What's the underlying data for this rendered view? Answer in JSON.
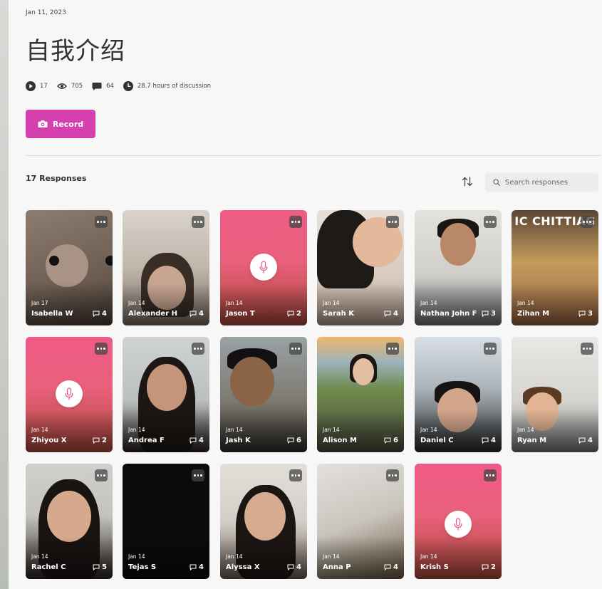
{
  "header": {
    "date": "Jan 11, 2023",
    "title": "自我介绍",
    "stats": {
      "videos": "17",
      "views": "705",
      "comments": "64",
      "hours": "28.7 hours of discussion"
    },
    "record_label": "Record"
  },
  "responses": {
    "count_label": "17 Responses",
    "search_placeholder": "Search responses",
    "items": [
      {
        "date": "Jan 17",
        "name": "Isabella W",
        "comments": "4",
        "type": "video"
      },
      {
        "date": "Jan 14",
        "name": "Alexander H",
        "comments": "4",
        "type": "video"
      },
      {
        "date": "Jan 14",
        "name": "Jason T",
        "comments": "2",
        "type": "audio"
      },
      {
        "date": "Jan 14",
        "name": "Sarah K",
        "comments": "4",
        "type": "video"
      },
      {
        "date": "Jan 14",
        "name": "Nathan John F",
        "comments": "3",
        "type": "video"
      },
      {
        "date": "Jan 14",
        "name": "Zihan M",
        "comments": "3",
        "type": "video"
      },
      {
        "date": "Jan 14",
        "name": "Zhiyou X",
        "comments": "2",
        "type": "audio"
      },
      {
        "date": "Jan 14",
        "name": "Andrea F",
        "comments": "4",
        "type": "video"
      },
      {
        "date": "Jan 14",
        "name": "Jash K",
        "comments": "6",
        "type": "video"
      },
      {
        "date": "Jan 14",
        "name": "Alison M",
        "comments": "6",
        "type": "video"
      },
      {
        "date": "Jan 14",
        "name": "Daniel C",
        "comments": "4",
        "type": "video"
      },
      {
        "date": "Jan 14",
        "name": "Ryan M",
        "comments": "4",
        "type": "video"
      },
      {
        "date": "Jan 14",
        "name": "Rachel C",
        "comments": "5",
        "type": "video"
      },
      {
        "date": "Jan 14",
        "name": "Tejas S",
        "comments": "4",
        "type": "video"
      },
      {
        "date": "Jan 14",
        "name": "Alyssa X",
        "comments": "4",
        "type": "video"
      },
      {
        "date": "Jan 14",
        "name": "Anna P",
        "comments": "4",
        "type": "video"
      },
      {
        "date": "Jan 14",
        "name": "Krish S",
        "comments": "2",
        "type": "audio"
      }
    ]
  },
  "colors": {
    "accent": "#d63fae",
    "audio_gradient_top": "#ef5b86",
    "audio_gradient_bottom": "#b04a3c"
  },
  "thumbnail_overlay_text": "IC CHITTIAG"
}
